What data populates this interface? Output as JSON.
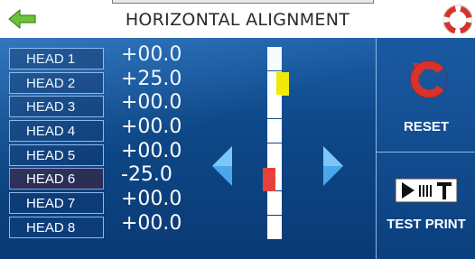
{
  "header": {
    "title": "HORIZONTAL ALIGNMENT",
    "back_icon": "back-arrow-icon",
    "help_icon": "lifebuoy-help-icon"
  },
  "heads": [
    {
      "label": "HEAD 1",
      "value": "+00.0",
      "marker": "none"
    },
    {
      "label": "HEAD 2",
      "value": "+25.0",
      "marker": "yellow"
    },
    {
      "label": "HEAD 3",
      "value": "+00.0",
      "marker": "none"
    },
    {
      "label": "HEAD 4",
      "value": "+00.0",
      "marker": "none"
    },
    {
      "label": "HEAD 5",
      "value": "+00.0",
      "marker": "none"
    },
    {
      "label": "HEAD 6",
      "value": "-25.0",
      "marker": "red",
      "selected": true
    },
    {
      "label": "HEAD 7",
      "value": "+00.0",
      "marker": "none"
    },
    {
      "label": "HEAD 8",
      "value": "+00.0",
      "marker": "none"
    }
  ],
  "controls": {
    "decrease_icon": "arrow-left-icon",
    "increase_icon": "arrow-right-icon"
  },
  "side": {
    "reset_label": "RESET",
    "reset_icon": "reset-icon",
    "test_print_label": "TEST PRINT",
    "test_print_icon": "test-print-icon"
  },
  "colors": {
    "background": "#0b3f7e",
    "yellow_marker": "#f2ea00",
    "red_marker": "#e8403a",
    "back_arrow": "#6ec23a",
    "reset_red": "#d8322a"
  }
}
